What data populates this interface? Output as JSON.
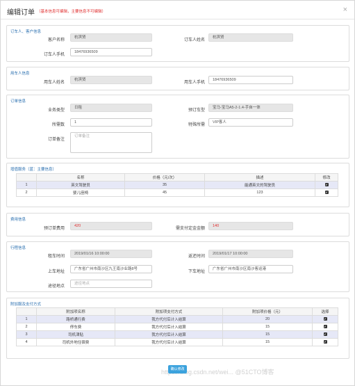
{
  "header": {
    "title": "编辑订单",
    "notice": "（基本信息可编辑，主要信息不可编辑）",
    "close": "×"
  },
  "orderer": {
    "title": "订车人、客户信息",
    "customer_label": "客户名称",
    "customer_value": "杭滨贤",
    "orderer_name_label": "订车人姓名",
    "orderer_name_value": "杭滨贤",
    "orderer_phone_label": "订车人手机",
    "orderer_phone_value": "18476936509"
  },
  "user": {
    "title": "用车人信息",
    "name_label": "用车人姓名",
    "name_value": "杭滨贤",
    "phone_label": "用车人手机",
    "phone_value": "18476936509"
  },
  "order": {
    "title": "订单信息",
    "biz_type_label": "业务类型",
    "biz_type_value": "日租",
    "car_type_label": "预订车型",
    "car_type_value": "宝马-宝马A5-2-1.4-手自一体",
    "car_count_label": "所需数",
    "car_count_value": "1",
    "special_label": "特殊所需",
    "special_value": "VIP客人",
    "remark_label": "订单备注",
    "remark_value": "订单备注"
  },
  "services": {
    "title": "增值服务（蓝：主要信息）",
    "headers": [
      "",
      "名称",
      "价格（元/次）",
      "描述",
      "修改"
    ],
    "rows": [
      {
        "idx": "1",
        "name": "英文驾驶员",
        "price": "35",
        "desc": "能通英文的驾驶员",
        "check": "✔"
      },
      {
        "idx": "2",
        "name": "婴儿座椅",
        "price": "45",
        "desc": "123",
        "check": "✔"
      }
    ]
  },
  "fees": {
    "title": "费用信息",
    "fee_label": "预订单费用",
    "fee_value": "420",
    "pay_label": "需支付定金金额",
    "pay_value": "140"
  },
  "trip": {
    "title": "行程信息",
    "pickup_time_label": "租车时间",
    "pickup_time_value": "2019/01/16 10:00:00",
    "return_time_label": "返还时间",
    "return_time_value": "2019/01/17 10:00:00",
    "pickup_addr_label": "上车地址",
    "pickup_addr_value": "广东省广州市南沙区九王南沙业路8号",
    "drop_addr_label": "下车地址",
    "drop_addr_value": "广东省广州市南沙区南沙客运港",
    "via_label": "途径地点",
    "via_placeholder": "途径地点"
  },
  "extra": {
    "title": "附加服及支付方式",
    "headers": [
      "",
      "附加项名称",
      "附加项支付方式",
      "附加项价格（元）",
      "选择"
    ],
    "rows": [
      {
        "idx": "1",
        "name": "路桥通行费",
        "method": "我方代付后计入结算",
        "price": "20",
        "check": "✔"
      },
      {
        "idx": "2",
        "name": "停车费",
        "method": "我方代付后计入结算",
        "price": "15",
        "check": "✔"
      },
      {
        "idx": "3",
        "name": "司机津贴",
        "method": "我方代付后计入结算",
        "price": "15",
        "check": "✔"
      },
      {
        "idx": "4",
        "name": "司机外地住宿费",
        "method": "我方代付后计入结算",
        "price": "15",
        "check": "✔"
      }
    ]
  },
  "submit_label": "确认修改",
  "watermark": "https://blog.csdn.net/wei... @51CTO博客"
}
